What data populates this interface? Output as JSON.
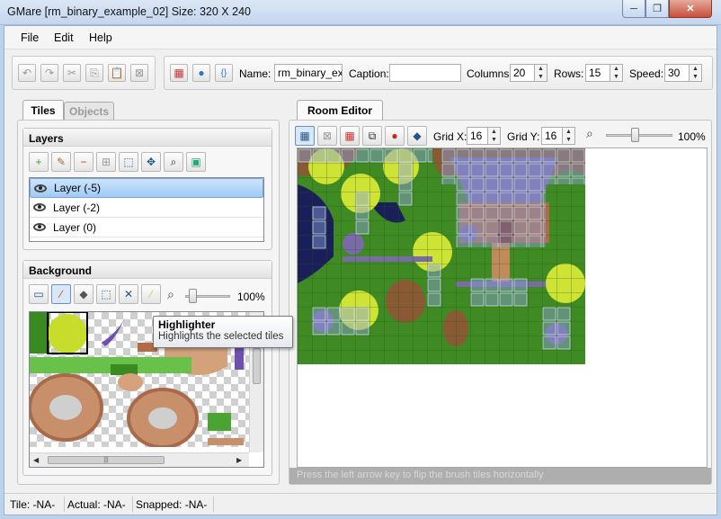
{
  "window": {
    "title": "GMare [rm_binary_example_02] Size: 320 X 240",
    "min": "─",
    "max": "❐",
    "close": "✕"
  },
  "menu": [
    "File",
    "Edit",
    "Help"
  ],
  "room": {
    "name_label": "Name:",
    "name_value": "rm_binary_exam",
    "caption_label": "Caption:",
    "caption_value": "",
    "columns_label": "Columns:",
    "columns_value": "20",
    "rows_label": "Rows:",
    "rows_value": "15",
    "speed_label": "Speed:",
    "speed_value": "30"
  },
  "tabs": {
    "tiles": "Tiles",
    "objects": "Objects",
    "room_editor": "Room Editor"
  },
  "layers": {
    "title": "Layers",
    "items": [
      {
        "label": "Layer (-5)",
        "selected": true
      },
      {
        "label": "Layer (-2)",
        "selected": false
      },
      {
        "label": "Layer (0)",
        "selected": false
      }
    ]
  },
  "background": {
    "title": "Background",
    "zoom": "100%",
    "scroll_glyph": "|||"
  },
  "editor": {
    "grid_x_label": "Grid X:",
    "grid_x_value": "16",
    "grid_y_label": "Grid Y:",
    "grid_y_value": "16",
    "zoom": "100%",
    "hint": "Press the left arrow key to flip the brush tiles horizontally"
  },
  "tooltip": {
    "title": "Highlighter",
    "body": "Highlights the selected tiles"
  },
  "status": {
    "tile": "Tile: -NA-",
    "actual": "Actual: -NA-",
    "snapped": "Snapped: -NA-"
  },
  "colors": {
    "grass": "#3f8a22",
    "water": "#1a1f5a",
    "roof": "#7a6aa8",
    "tree": "#d8e83a",
    "selection": "#9fcaf5"
  }
}
